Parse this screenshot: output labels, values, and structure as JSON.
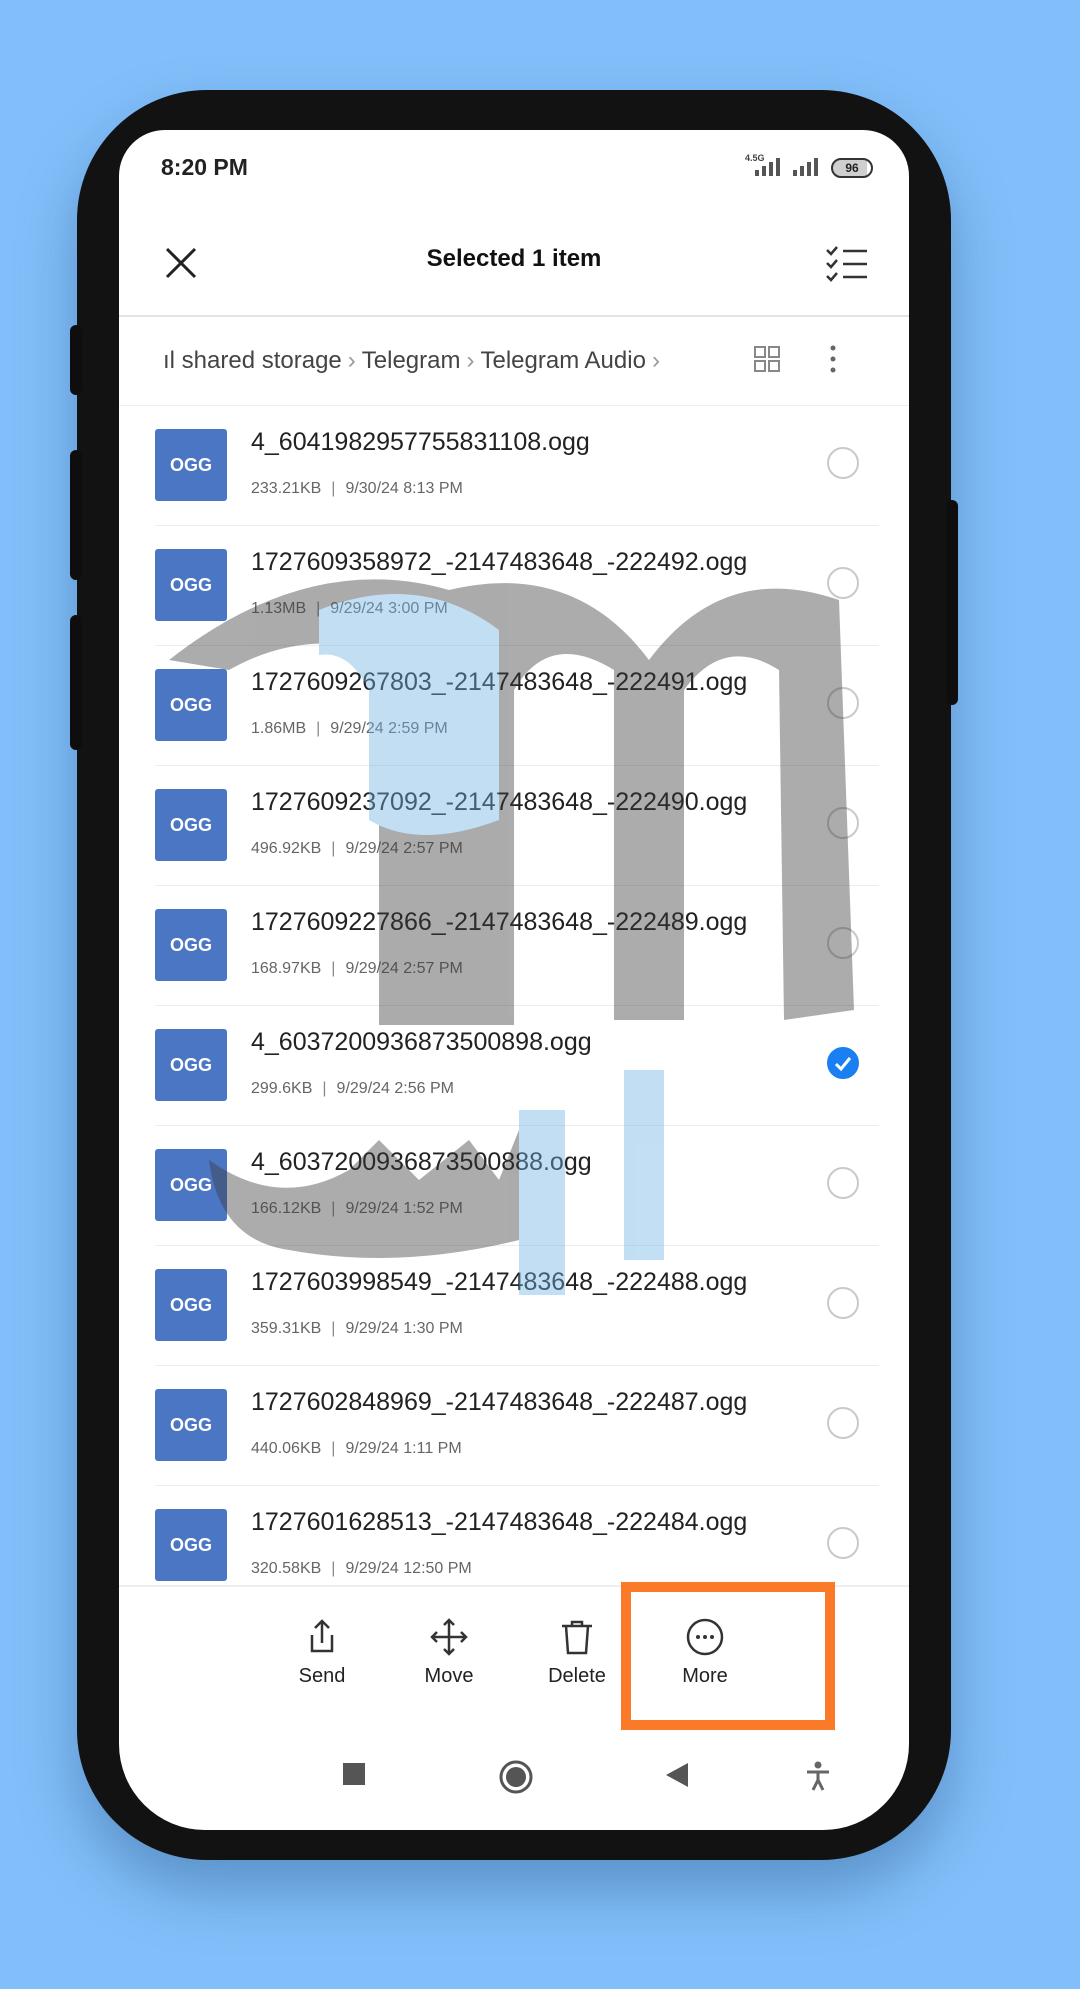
{
  "status_bar": {
    "time": "8:20 PM",
    "network": "4.5G",
    "battery": "96"
  },
  "header": {
    "title": "Selected 1 item"
  },
  "breadcrumb": {
    "items": [
      "ıl shared storage",
      "Telegram",
      "Telegram Audio"
    ]
  },
  "files": [
    {
      "type": "OGG",
      "name": "4_6041982957755831108.ogg",
      "size": "233.21KB",
      "date": "9/30/24 8:13 PM",
      "selected": false
    },
    {
      "type": "OGG",
      "name": "1727609358972_-2147483648_-222492.ogg",
      "size": "1.13MB",
      "date": "9/29/24 3:00 PM",
      "selected": false
    },
    {
      "type": "OGG",
      "name": "1727609267803_-2147483648_-222491.ogg",
      "size": "1.86MB",
      "date": "9/29/24 2:59 PM",
      "selected": false
    },
    {
      "type": "OGG",
      "name": "1727609237092_-2147483648_-222490.ogg",
      "size": "496.92KB",
      "date": "9/29/24 2:57 PM",
      "selected": false
    },
    {
      "type": "OGG",
      "name": "1727609227866_-2147483648_-222489.ogg",
      "size": "168.97KB",
      "date": "9/29/24 2:57 PM",
      "selected": false
    },
    {
      "type": "OGG",
      "name": "4_6037200936873500898.ogg",
      "size": "299.6KB",
      "date": "9/29/24 2:56 PM",
      "selected": true
    },
    {
      "type": "OGG",
      "name": "4_6037200936873500888.ogg",
      "size": "166.12KB",
      "date": "9/29/24 1:52 PM",
      "selected": false
    },
    {
      "type": "OGG",
      "name": "1727603998549_-2147483648_-222488.ogg",
      "size": "359.31KB",
      "date": "9/29/24 1:30 PM",
      "selected": false
    },
    {
      "type": "OGG",
      "name": "1727602848969_-2147483648_-222487.ogg",
      "size": "440.06KB",
      "date": "9/29/24 1:11 PM",
      "selected": false
    },
    {
      "type": "OGG",
      "name": "1727601628513_-2147483648_-222484.ogg",
      "size": "320.58KB",
      "date": "9/29/24 12:50 PM",
      "selected": false
    }
  ],
  "actions": {
    "send": "Send",
    "move": "Move",
    "delete": "Delete",
    "more": "More"
  },
  "colors": {
    "background": "#82bffa",
    "file_badge": "#4a76c4",
    "selected_check": "#1a7ff0",
    "highlight": "#fa7a2a"
  }
}
